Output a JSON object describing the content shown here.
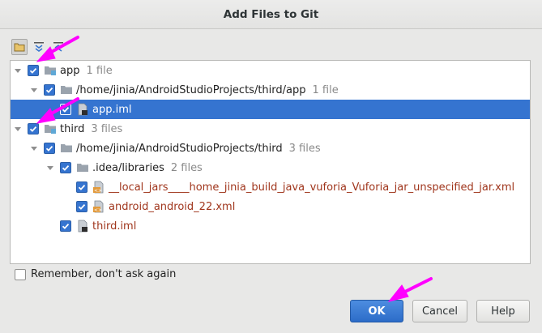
{
  "window": {
    "title": "Add Files to Git"
  },
  "toolbar": {
    "buttons": [
      "group-by-directory-icon",
      "expand-all-icon",
      "collapse-all-icon"
    ]
  },
  "tree": [
    {
      "level": 0,
      "expanded": true,
      "checked": true,
      "icon": "module-folder-icon",
      "name": "app",
      "count": "1 file",
      "selected": false
    },
    {
      "level": 1,
      "expanded": true,
      "checked": true,
      "icon": "folder-icon",
      "name": "/home/jinia/AndroidStudioProjects/third/app",
      "count": "1 file",
      "selected": false
    },
    {
      "level": 2,
      "expanded": null,
      "checked": true,
      "icon": "iml-file-icon",
      "name": "app.iml",
      "count": "",
      "selected": true
    },
    {
      "level": 0,
      "expanded": true,
      "checked": true,
      "icon": "module-folder-icon",
      "name": "third",
      "count": "3 files",
      "selected": false
    },
    {
      "level": 1,
      "expanded": true,
      "checked": true,
      "icon": "folder-icon",
      "name": "/home/jinia/AndroidStudioProjects/third",
      "count": "3 files",
      "selected": false
    },
    {
      "level": 2,
      "expanded": true,
      "checked": true,
      "icon": "folder-icon",
      "name": ".idea/libraries",
      "count": "2 files",
      "selected": false
    },
    {
      "level": 3,
      "expanded": null,
      "checked": true,
      "icon": "xml-file-icon",
      "name": "__local_jars____home_jinia_build_java_vuforia_Vuforia_jar_unspecified_jar.xml",
      "count": "",
      "selected": false,
      "red": true
    },
    {
      "level": 3,
      "expanded": null,
      "checked": true,
      "icon": "xml-file-icon",
      "name": "android_android_22.xml",
      "count": "",
      "selected": false,
      "red": true
    },
    {
      "level": 2,
      "expanded": null,
      "checked": true,
      "icon": "iml-file-icon",
      "name": "third.iml",
      "count": "",
      "selected": false,
      "red": true
    }
  ],
  "remember": {
    "label": "Remember, don't ask again",
    "checked": false
  },
  "buttons": {
    "ok": "OK",
    "cancel": "Cancel",
    "help": "Help"
  },
  "colors": {
    "accent": "#3574d0",
    "annotation": "#ff00ff",
    "untracked": "#a0361d"
  }
}
